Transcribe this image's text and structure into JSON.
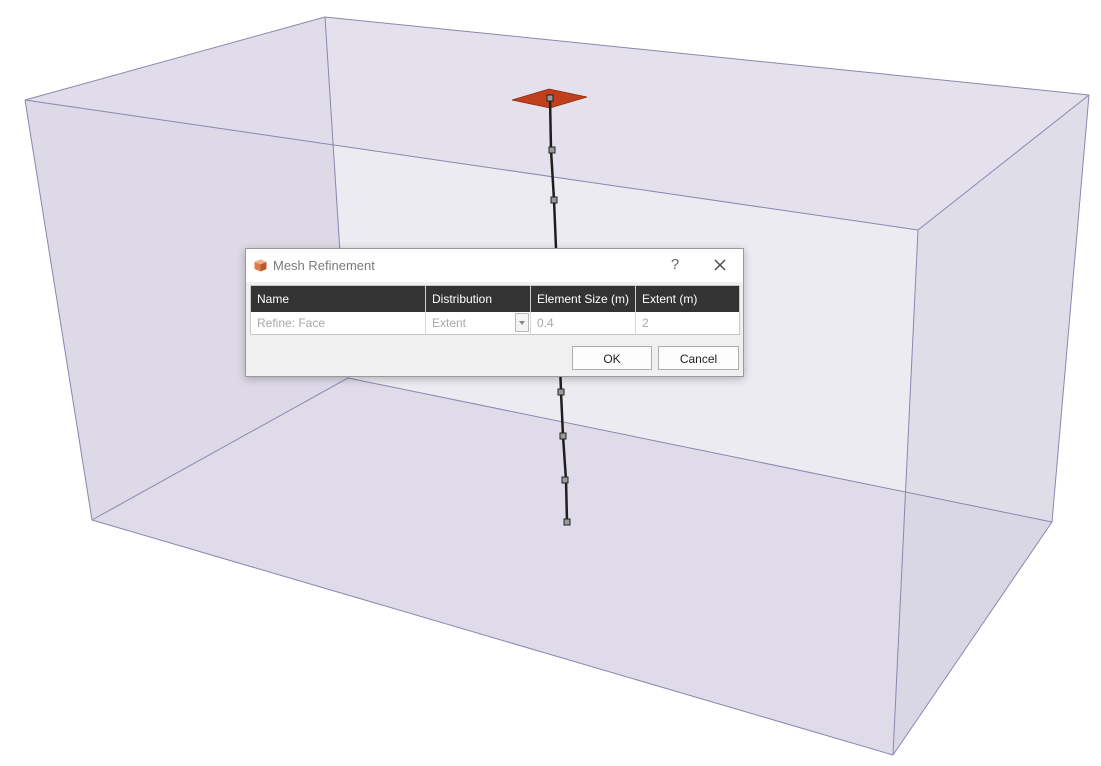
{
  "dialog": {
    "title": "Mesh Refinement",
    "help_label": "?",
    "icon": "mesh-refinement-app-icon",
    "close_icon": "close-icon"
  },
  "table": {
    "columns": [
      "Name",
      "Distribution",
      "Element Size (m)",
      "Extent (m)"
    ],
    "rows": [
      {
        "name": "Refine: Face",
        "distribution": "Extent",
        "element_size": "0.4",
        "extent": "2"
      }
    ]
  },
  "buttons": {
    "ok": "OK",
    "cancel": "Cancel"
  },
  "colors": {
    "box_fill": "#dcd9e6",
    "box_edge": "#8a87b0",
    "plate": "#c0401e",
    "header_bg": "#333333"
  }
}
